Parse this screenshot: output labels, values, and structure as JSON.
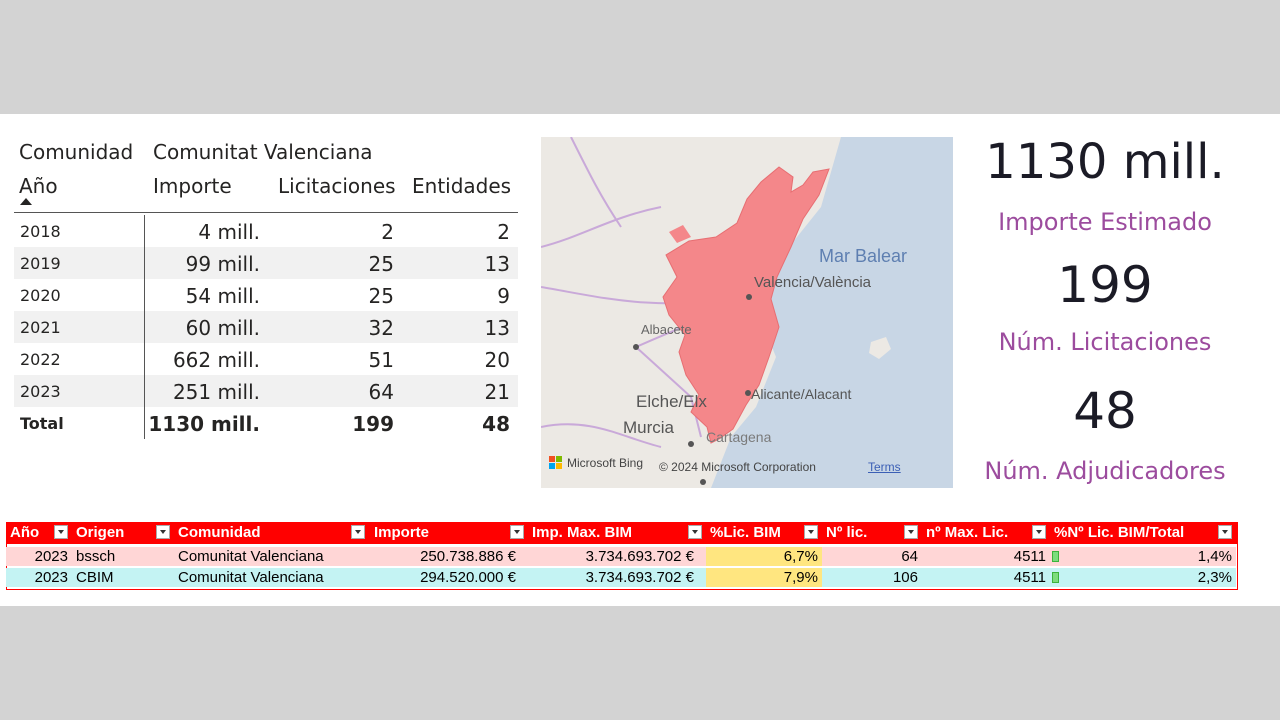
{
  "matrix": {
    "comunidad_label": "Comunidad",
    "comunidad_value": "Comunitat Valenciana",
    "columns": [
      "Año",
      "Importe",
      "Licitaciones",
      "Entidades"
    ],
    "rows": [
      {
        "year": "2018",
        "importe": "4 mill.",
        "licitaciones": "2",
        "entidades": "2"
      },
      {
        "year": "2019",
        "importe": "99 mill.",
        "licitaciones": "25",
        "entidades": "13"
      },
      {
        "year": "2020",
        "importe": "54 mill.",
        "licitaciones": "25",
        "entidades": "9"
      },
      {
        "year": "2021",
        "importe": "60 mill.",
        "licitaciones": "32",
        "entidades": "13"
      },
      {
        "year": "2022",
        "importe": "662 mill.",
        "licitaciones": "51",
        "entidades": "20"
      },
      {
        "year": "2023",
        "importe": "251 mill.",
        "licitaciones": "64",
        "entidades": "21"
      }
    ],
    "total": {
      "year": "Total",
      "importe": "1130 mill.",
      "licitaciones": "199",
      "entidades": "48"
    }
  },
  "map": {
    "labels": {
      "sea": "Mar Balear",
      "valencia": "Valencia/València",
      "albacete": "Albacete",
      "alicante": "Alicante/Alacant",
      "elche": "Elche/Elx",
      "murcia": "Murcia",
      "cartagena": "Cartagena"
    },
    "attribution": "© 2024 Microsoft Corporation",
    "brand": "Microsoft Bing",
    "terms": "Terms",
    "colors": {
      "region": "#f4878a",
      "sea": "#c8d6e5",
      "land": "#ece9e4"
    }
  },
  "cards": [
    {
      "value": "1130 mill.",
      "label": "Importe Estimado"
    },
    {
      "value": "199",
      "label": "Núm. Licitaciones"
    },
    {
      "value": "48",
      "label": "Núm. Adjudicadores"
    }
  ],
  "excel": {
    "headers": [
      "Año",
      "Origen",
      "Comunidad",
      "Importe",
      "Imp. Max. BIM",
      "%Lic. BIM",
      "Nº lic.",
      "nº Max. Lic.",
      "%Nº Lic. BIM/Total"
    ],
    "rows": [
      {
        "year": "2023",
        "origen": "bssch",
        "comunidad": "Comunitat Valenciana",
        "importe": "250.738.886 €",
        "max_bim": "3.734.693.702 €",
        "pct_bim": "6,7%",
        "n_lic": "64",
        "max_lic": "4511",
        "pct_total": "1,4%",
        "bar_fraction": 0.014
      },
      {
        "year": "2023",
        "origen": "CBIM",
        "comunidad": "Comunitat Valenciana",
        "importe": "294.520.000 €",
        "max_bim": "3.734.693.702 €",
        "pct_bim": "7,9%",
        "n_lic": "106",
        "max_lic": "4511",
        "pct_total": "2,3%",
        "bar_fraction": 0.023
      }
    ],
    "colors": {
      "header": "#ff0000",
      "row1": "#ffd6d6",
      "row2": "#c4f3f3",
      "highlight": "#ffe680"
    }
  }
}
